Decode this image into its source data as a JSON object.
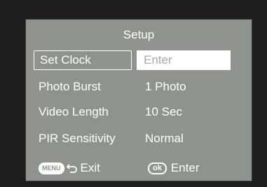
{
  "title": "Setup",
  "menu_items": [
    {
      "label": "Set Clock",
      "value": "Enter",
      "selected": true
    },
    {
      "label": "Photo Burst",
      "value": "1 Photo",
      "selected": false
    },
    {
      "label": "Video Length",
      "value": "10 Sec",
      "selected": false
    },
    {
      "label": "PIR Sensitivity",
      "value": "Normal",
      "selected": false
    }
  ],
  "footer": {
    "menu_button": "MENU",
    "exit_label": "Exit",
    "ok_button": "ok",
    "enter_label": "Enter"
  },
  "colors": {
    "screen_bg": "#8f938f",
    "text": "#ffffff",
    "highlight_bg": "#ffffff",
    "highlight_text": "#a8a8a8"
  }
}
